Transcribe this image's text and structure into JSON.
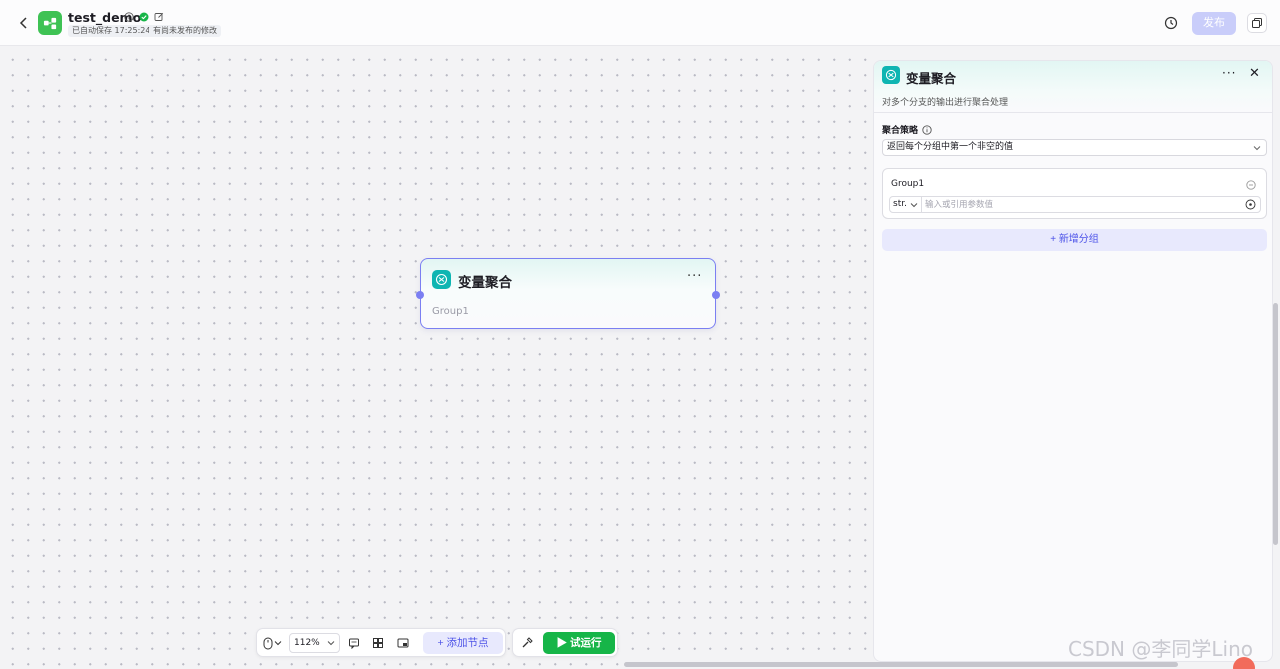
{
  "topbar": {
    "back_icon": "chevron-left-icon",
    "app_title": "test_demo",
    "autosave_badge": "已自动保存 17:25:24",
    "unpublished_badge": "有尚未发布的修改",
    "publish_label": "发布",
    "brand_color": "#3ec254",
    "publish_color": "#c9cdfa"
  },
  "node": {
    "title": "变量聚合",
    "group_label": "Group1",
    "more_label": "···",
    "accent_color": "#7b7ff2",
    "icon_color": "#0eb5b2"
  },
  "panel": {
    "title": "变量聚合",
    "description": "对多个分支的输出进行聚合处理",
    "more_label": "···",
    "close_label": "✕",
    "strategy_label": "聚合策略",
    "strategy_value": "返回每个分组中第一个非空的值",
    "group": {
      "name": "Group1",
      "type_value": "str.",
      "input_placeholder": "输入或引用参数值"
    },
    "add_group_label": "新增分组"
  },
  "toolbar": {
    "zoom_value": "112%",
    "add_node_label": "添加节点",
    "run_label": "试运行",
    "run_color": "#16b548"
  },
  "watermark": "CSDN @李同学Lino"
}
